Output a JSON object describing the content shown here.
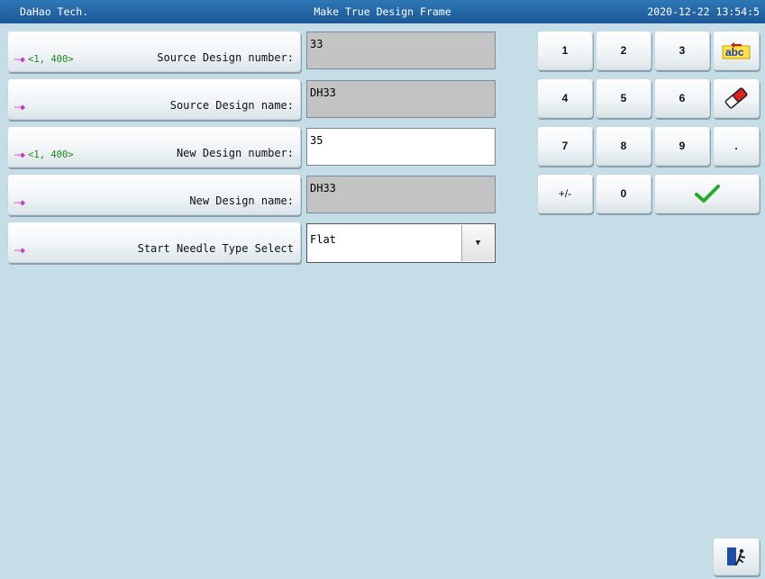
{
  "titlebar": {
    "company": "DaHao Tech.",
    "title": "Make True Design Frame",
    "datetime": "2020-12-22 13:54:5"
  },
  "rows": [
    {
      "range": "<1, 400>",
      "label": "Source Design number:",
      "value": "33"
    },
    {
      "range": "",
      "label": "Source Design name:",
      "value": "DH33"
    },
    {
      "range": "<1, 400>",
      "label": "New Design number:",
      "value": "35"
    },
    {
      "range": "",
      "label": "New Design name:",
      "value": "DH33"
    },
    {
      "range": "",
      "label": "Start Needle Type Select",
      "value": "Flat"
    }
  ],
  "keypad": {
    "keys": [
      "1",
      "2",
      "3",
      "4",
      "5",
      "6",
      "7",
      "8",
      "9",
      ".",
      "+/-",
      "0"
    ],
    "icons": {
      "abc": "abc-keyboard-icon",
      "eraser": "eraser-icon",
      "confirm": "checkmark-icon",
      "exit": "exit-door-icon"
    },
    "abc_text": "abc"
  },
  "colors": {
    "titlebar": "#1f60a0",
    "background": "#c5dde6",
    "range_text": "#1c8a1c",
    "confirm": "#2aa82a"
  }
}
